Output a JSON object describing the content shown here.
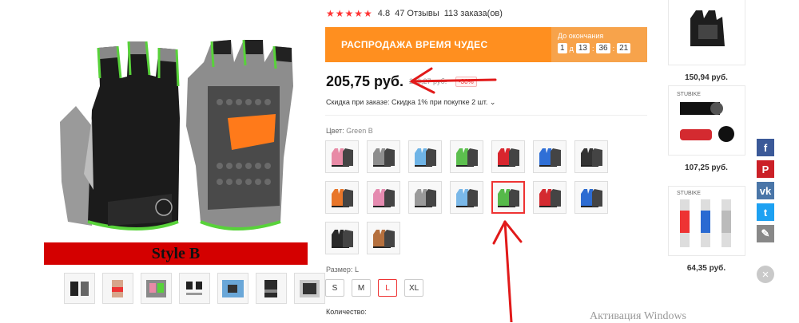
{
  "product": {
    "rating_stars": "★★★★★",
    "rating_value": "4.8",
    "reviews": "47 Отзывы",
    "orders": "113 заказа(ов)",
    "style_banner": "Style B"
  },
  "sale": {
    "title": "РАСПРОДАЖА ВРЕМЯ ЧУДЕС",
    "timer_label": "До окончания",
    "timer": {
      "days": "1",
      "day_suffix": "д",
      "hours": "13",
      "minutes": "36",
      "seconds": "21"
    }
  },
  "price": {
    "current": "205,75 руб.",
    "old": "220,27 руб.",
    "discount": "-30%",
    "promo": "Скидка при заказе: Скидка 1% при покупке 2 шт. ⌄"
  },
  "color": {
    "label": "Цвет:",
    "value": "Green B",
    "swatches": [
      {
        "name": "pink-a",
        "c": "#e88aa6"
      },
      {
        "name": "gray-a",
        "c": "#8e8e8e"
      },
      {
        "name": "sky-a",
        "c": "#6fb4e6"
      },
      {
        "name": "green-a",
        "c": "#5cbf4e"
      },
      {
        "name": "red-a",
        "c": "#d8262e"
      },
      {
        "name": "blue-a",
        "c": "#2f6fd6"
      },
      {
        "name": "black-a",
        "c": "#333333"
      },
      {
        "name": "orange-b",
        "c": "#e8762a"
      },
      {
        "name": "pink-b",
        "c": "#e58bb0"
      },
      {
        "name": "gray-b",
        "c": "#9a9a9a"
      },
      {
        "name": "sky-b",
        "c": "#7ab8e8"
      },
      {
        "name": "green-b",
        "c": "#56b94a"
      },
      {
        "name": "red-b",
        "c": "#d42a30"
      },
      {
        "name": "blue-b",
        "c": "#2d6cd2"
      },
      {
        "name": "black-b",
        "c": "#2a2a2a"
      },
      {
        "name": "brown-b",
        "c": "#b5703e"
      }
    ],
    "selected_index": 11
  },
  "size": {
    "label": "Размер:",
    "value": "L",
    "options": [
      "S",
      "M",
      "L",
      "XL"
    ],
    "selected": "L"
  },
  "quantity_label": "Количество:",
  "recommendations": [
    {
      "price": "150,94 руб."
    },
    {
      "price": "107,25 руб.",
      "brand": "STUBIKE"
    },
    {
      "price": "64,35 руб.",
      "brand": "STUBIKE"
    }
  ],
  "share": [
    {
      "name": "facebook",
      "glyph": "f",
      "color": "#3b5998"
    },
    {
      "name": "pinterest",
      "glyph": "P",
      "color": "#cb2027"
    },
    {
      "name": "vk",
      "glyph": "vk",
      "color": "#4a76a8"
    },
    {
      "name": "twitter",
      "glyph": "t",
      "color": "#1da1f2"
    },
    {
      "name": "edit",
      "glyph": "✎",
      "color": "#888888"
    }
  ],
  "close_glyph": "×",
  "watermark": "Активация Windows",
  "colors": {
    "accent": "#e33333",
    "sale_bg": "#ff8f1f",
    "banner_red": "#d40000",
    "arrow_red": "#e11a1a"
  }
}
